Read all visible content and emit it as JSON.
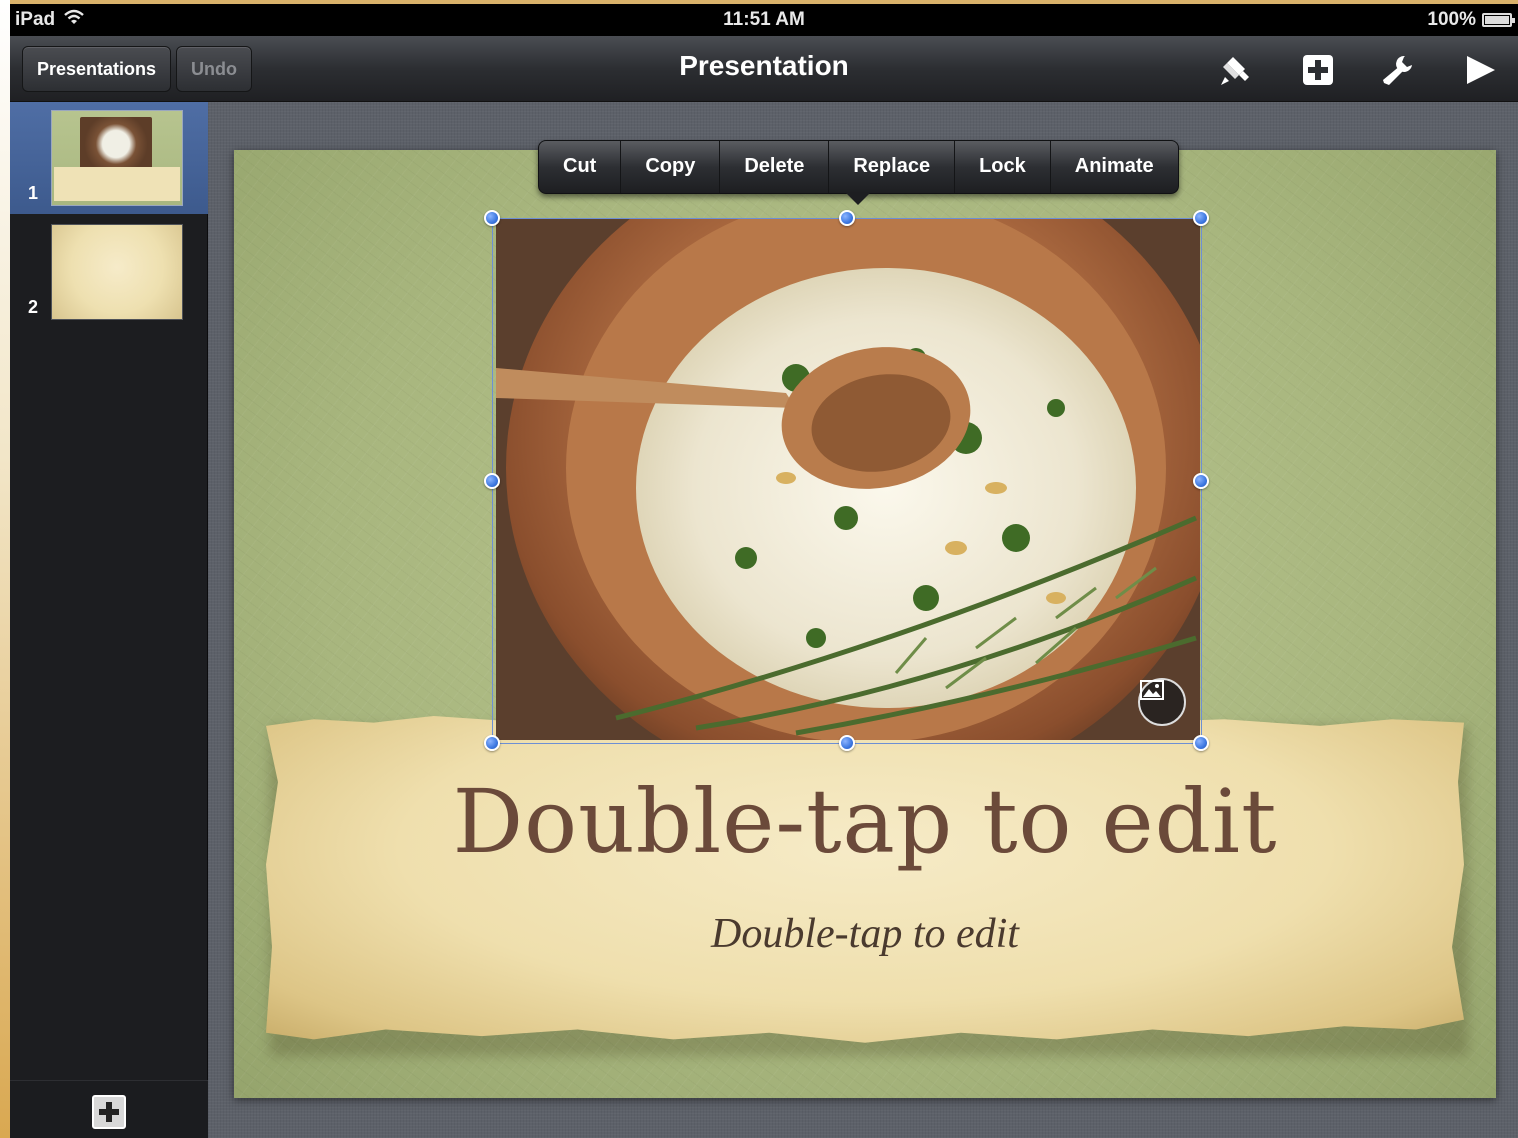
{
  "status_bar": {
    "device": "iPad",
    "time": "11:51 AM",
    "battery": "100%"
  },
  "toolbar": {
    "presentations_label": "Presentations",
    "undo_label": "Undo",
    "title": "Presentation",
    "icons": [
      "paintbrush-icon",
      "insert-icon",
      "wrench-icon",
      "play-icon"
    ]
  },
  "sidebar": {
    "slides": [
      {
        "number": "1",
        "selected": true
      },
      {
        "number": "2",
        "selected": false
      }
    ]
  },
  "edit_menu": {
    "items": [
      "Cut",
      "Copy",
      "Delete",
      "Replace",
      "Lock",
      "Animate"
    ]
  },
  "slide": {
    "title": "Double-tap to edit",
    "subtitle": "Double-tap to edit"
  },
  "colors": {
    "selection": "#3d78e0",
    "slide_background": "#a8b67e",
    "title_text": "#6b4a3a",
    "selected_thumb": "#4f6ea5"
  }
}
